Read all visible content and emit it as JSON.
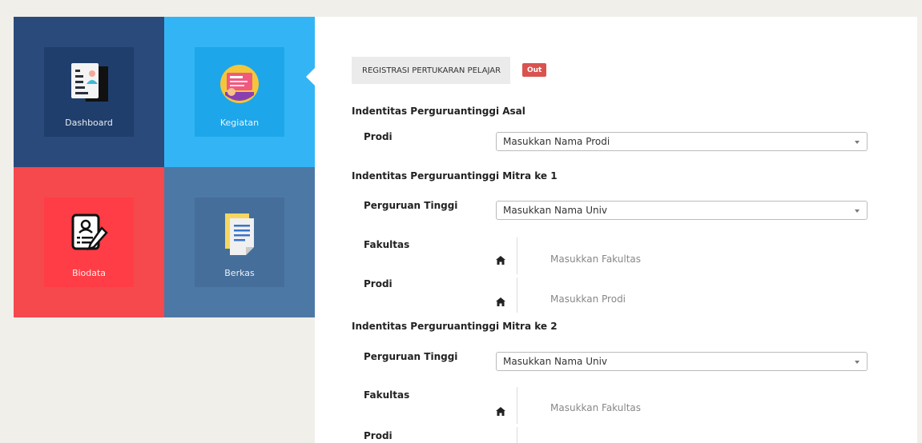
{
  "tiles": [
    {
      "label": "Dashboard",
      "bg": "#2a4a7c",
      "inner_bg": "#1f3e6c",
      "icon": "document-person-icon"
    },
    {
      "label": "Kegiatan",
      "bg": "#33b5f5",
      "inner_bg": "#1ea6ea",
      "icon": "presentation-hand-icon"
    },
    {
      "label": "Biodata",
      "bg": "#f5494e",
      "inner_bg": "#ff3d46",
      "icon": "form-pencil-icon"
    },
    {
      "label": "Berkas",
      "bg": "#4c78a6",
      "inner_bg": "#466e9b",
      "icon": "files-icon"
    }
  ],
  "header": {
    "title": "REGISTRASI PERTUKARAN PELAJAR",
    "badge": "Out"
  },
  "sections": {
    "asal": {
      "title": "Indentitas Perguruantinggi Asal",
      "prodi_label": "Prodi",
      "prodi_select": "Masukkan Nama Prodi"
    },
    "mitra1": {
      "title": "Indentitas Perguruantinggi Mitra ke 1",
      "pt_label": "Perguruan Tinggi",
      "pt_select": "Masukkan Nama Univ",
      "fakultas_label": "Fakultas",
      "fakultas_placeholder": "Masukkan Fakultas",
      "prodi_label": "Prodi",
      "prodi_placeholder": "Masukkan Prodi"
    },
    "mitra2": {
      "title": "Indentitas Perguruantinggi Mitra ke 2",
      "pt_label": "Perguruan Tinggi",
      "pt_select": "Masukkan Nama Univ",
      "fakultas_label": "Fakultas",
      "fakultas_placeholder": "Masukkan Fakultas",
      "prodi_label": "Prodi"
    }
  },
  "colors": {
    "badge": "#d9534f",
    "page_bg": "#f0efea",
    "panel_bg": "#ffffff"
  }
}
